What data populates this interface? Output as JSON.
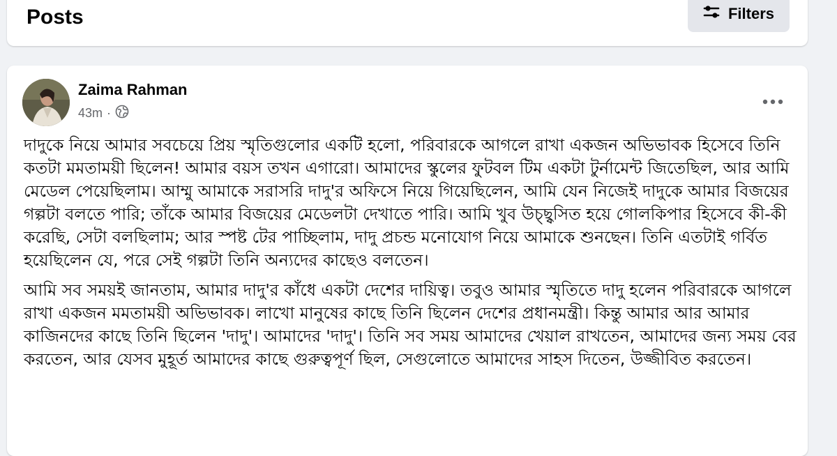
{
  "header": {
    "title": "Posts",
    "filters_label": "Filters",
    "filters_icon": "sliders-icon"
  },
  "post": {
    "author": "Zaima Rahman",
    "time": "43m",
    "separator": "·",
    "privacy_icon": "globe-icon",
    "more_icon": "more-horizontal-icon",
    "paragraphs": [
      "দাদুকে নিয়ে আমার সবচেয়ে প্রিয় স্মৃতিগুলোর একটি হলো, পরিবারকে আগলে রাখা একজন অভিভাবক হিসেবে তিনি কতটা মমতাময়ী ছিলেন! আমার বয়স তখন এগারো। আমাদের স্কুলের ফুটবল টিম একটা টুর্নামেন্ট জিতেছিল, আর আমি মেডেল পেয়েছিলাম। আম্মু আমাকে সরাসরি দাদু'র অফিসে নিয়ে গিয়েছিলেন, আমি যেন নিজেই দাদুকে আমার বিজয়ের গল্পটা বলতে পারি; তাঁকে আমার বিজয়ের মেডেলটা দেখাতে পারি। আমি খুব উচ্ছ্বসিত হয়ে গোলকিপার হিসেবে কী-কী করেছি, সেটা বলছিলাম; আর স্পষ্ট টের পাচ্ছিলাম, দাদু প্রচন্ড মনোযোগ নিয়ে আমাকে শুনছেন। তিনি এতটাই গর্বিত হয়েছিলেন যে, পরে সেই গল্পটা তিনি অন্যদের কাছেও বলতেন।",
      "আমি সব সময়ই জানতাম, আমার দাদু'র কাঁধে একটা দেশের দায়িত্ব। তবুও আমার স্মৃতিতে দাদু হলেন পরিবারকে আগলে রাখা একজন মমতাময়ী অভিভাবক। লাখো মানুষের কাছে তিনি ছিলেন দেশের প্রধানমন্ত্রী। কিন্তু আমার আর আমার কাজিনদের কাছে তিনি ছিলেন 'দাদু'। আমাদের 'দাদু'। তিনি সব সময় আমাদের খেয়াল রাখতেন, আমাদের জন্য সময় বের করতেন, আর যেসব মুহূর্ত আমাদের কাছে গুরুত্বপূর্ণ ছিল, সেগুলোতে আমাদের সাহস দিতেন, উজ্জীবিত করতেন।"
    ]
  }
}
